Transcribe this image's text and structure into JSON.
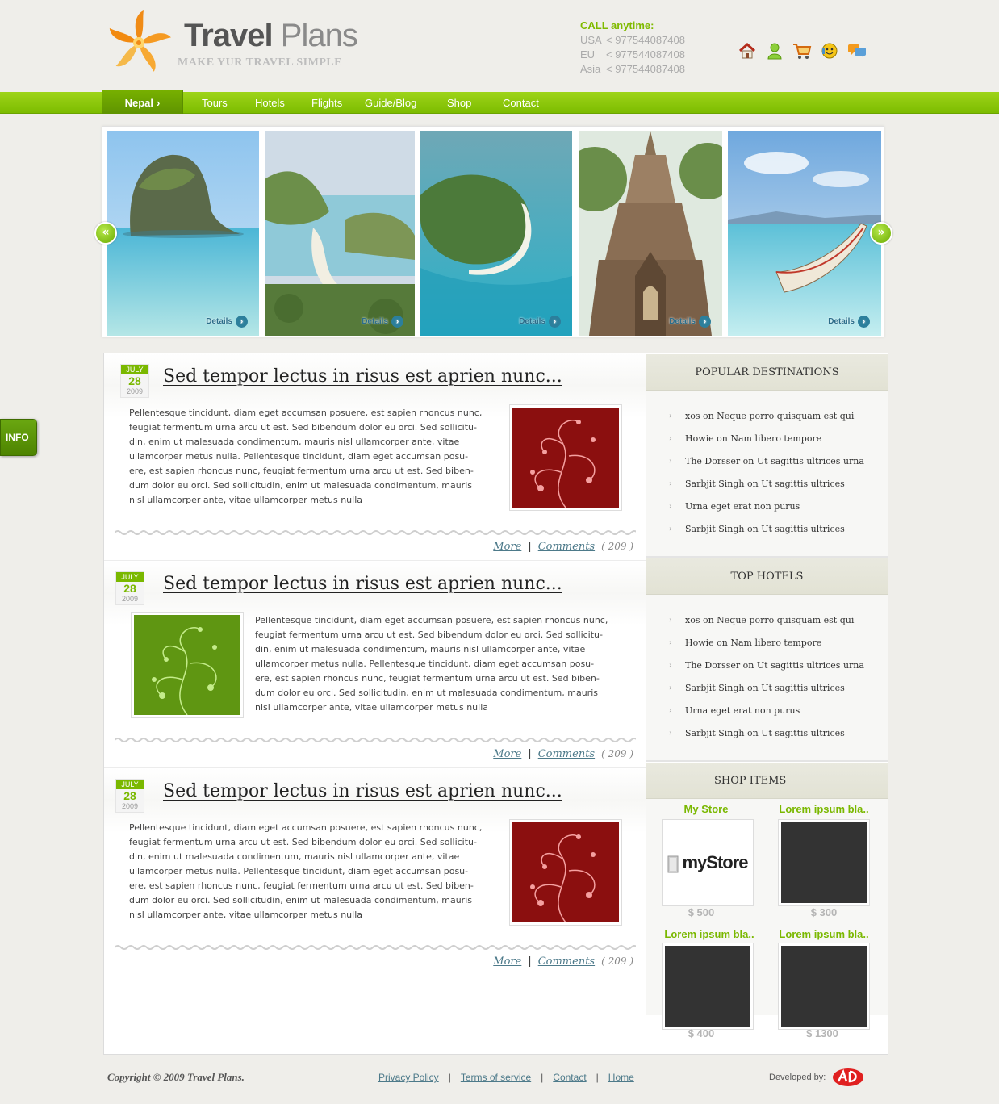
{
  "header": {
    "logo_word1": "Travel",
    "logo_word2": "Plans",
    "tagline": "MAKE YUR TRAVEL SIMPLE",
    "call_title": "CALL anytime:",
    "phones": [
      {
        "region": "USA",
        "number": "< 977544087408"
      },
      {
        "region": "EU",
        "number": "< 977544087408"
      },
      {
        "region": "Asia",
        "number": "< 977544087408"
      }
    ],
    "icons": [
      "home-icon",
      "user-icon",
      "cart-icon",
      "smiley-icon",
      "chat-icon"
    ]
  },
  "nav": {
    "active": "Nepal",
    "items": [
      "Tours",
      "Hotels",
      "Flights",
      "Guide/Blog",
      "Shop",
      "Contact"
    ]
  },
  "slider": {
    "details_label": "Details",
    "slides": [
      "rock-island",
      "island-beach",
      "aerial-island",
      "temple",
      "longtail-boat"
    ]
  },
  "info_tab": "INFO",
  "posts": [
    {
      "month": "JULY",
      "day": "28",
      "year": "2009",
      "title": "Sed tempor lectus in risus est aprien nunc...",
      "lines": [
        "Pellentesque tincidunt, diam eget accumsan posuere, est sapien rhoncus nunc,",
        "feugiat fermentum urna arcu ut est. Sed bibendum dolor eu orci. Sed sollicitu-",
        "din, enim ut malesuada condimentum, mauris nisl ullamcorper ante, vitae",
        "ullamcorper metus nulla. Pellentesque tincidunt, diam eget accumsan posu-",
        "ere, est sapien rhoncus nunc, feugiat fermentum urna arcu ut est. Sed biben-",
        "dum dolor eu orci. Sed sollicitudin, enim ut malesuada condimentum, mauris",
        "nisl ullamcorper ante, vitae ullamcorper metus nulla"
      ],
      "more": "More",
      "comments": "Comments",
      "count": "209",
      "image_color": "#8b0f0f"
    },
    {
      "month": "JULY",
      "day": "28",
      "year": "2009",
      "title": "Sed tempor lectus in risus est aprien nunc...",
      "lines": [
        "Pellentesque tincidunt, diam eget accumsan posuere, est sapien rhoncus nunc,",
        "feugiat fermentum urna arcu ut est. Sed bibendum dolor eu orci. Sed sollicitu-",
        "din, enim ut malesuada condimentum, mauris nisl ullamcorper ante, vitae",
        "ullamcorper metus nulla. Pellentesque tincidunt, diam eget accumsan posu-",
        "ere, est sapien rhoncus nunc, feugiat fermentum urna arcu ut est. Sed biben-",
        "dum dolor eu orci. Sed sollicitudin, enim ut malesuada condimentum, mauris",
        "nisl ullamcorper ante, vitae ullamcorper metus nulla"
      ],
      "more": "More",
      "comments": "Comments",
      "count": "209",
      "image_color": "#5f9612"
    },
    {
      "month": "JULY",
      "day": "28",
      "year": "2009",
      "title": "Sed tempor lectus in risus est aprien nunc...",
      "lines": [
        "Pellentesque tincidunt, diam eget accumsan posuere, est sapien rhoncus nunc,",
        "feugiat fermentum urna arcu ut est. Sed bibendum dolor eu orci. Sed sollicitu-",
        "din, enim ut malesuada condimentum, mauris nisl ullamcorper ante, vitae",
        "ullamcorper metus nulla. Pellentesque tincidunt, diam eget accumsan posu-",
        "ere, est sapien rhoncus nunc, feugiat fermentum urna arcu ut est. Sed biben-",
        "dum dolor eu orci. Sed sollicitudin, enim ut malesuada condimentum, mauris",
        "nisl ullamcorper ante, vitae ullamcorper metus nulla"
      ],
      "more": "More",
      "comments": "Comments",
      "count": "209",
      "image_color": "#8b0f0f"
    }
  ],
  "sidebar": {
    "popular_title": "POPULAR DESTINATIONS",
    "popular": [
      "xos on Neque porro quisquam est qui",
      "Howie on Nam libero tempore",
      "The Dorsser on Ut sagittis ultrices urna",
      "Sarbjit Singh on Ut sagittis ultrices",
      "Urna eget erat non purus",
      "Sarbjit Singh on Ut sagittis ultrices"
    ],
    "hotels_title": "TOP HOTELS",
    "hotels": [
      "xos on Neque porro quisquam est qui",
      "Howie on Nam libero tempore",
      "The Dorsser on Ut sagittis ultrices urna",
      "Sarbjit Singh on Ut sagittis ultrices",
      "Urna eget erat non purus",
      "Sarbjit Singh on Ut sagittis ultrices"
    ],
    "shop_title": "SHOP ITEMS",
    "shop": [
      {
        "name": "My Store",
        "price": "$ 500",
        "logo": "myStore"
      },
      {
        "name": "Lorem ipsum bla..",
        "price": "$ 300"
      },
      {
        "name": "Lorem ipsum bla..",
        "price": "$ 400"
      },
      {
        "name": "Lorem ipsum bla..",
        "price": "$ 1300"
      }
    ]
  },
  "footer": {
    "copyright": "Copyright © 2009 Travel Plans.",
    "links": [
      "Privacy Policy",
      "Terms of service",
      "Contact",
      "Home"
    ],
    "developed_by": "Developed by:"
  },
  "colors": {
    "accent_green": "#7ab800",
    "link_blue": "#4d7a8a",
    "background": "#efeeea"
  }
}
